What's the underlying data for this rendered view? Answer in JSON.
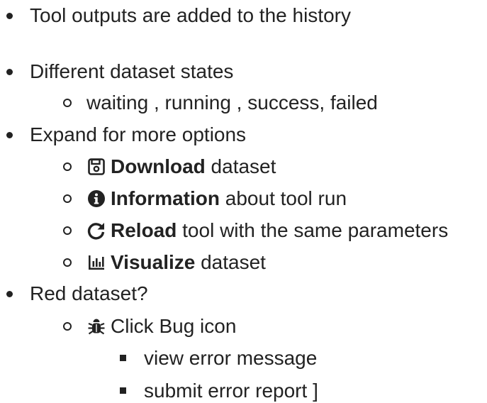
{
  "items": [
    {
      "text": "Tool outputs are added to the history"
    },
    {
      "text": "Different dataset states"
    },
    {
      "text": "waiting , running , success, failed"
    },
    {
      "text": "Expand for more options"
    },
    {
      "bold": "Download",
      "rest": " dataset",
      "icon": "floppy-disk-icon"
    },
    {
      "bold": "Information",
      "rest": " about tool run",
      "icon": "info-circle-icon"
    },
    {
      "bold": "Reload",
      "rest": " tool with the same parameters",
      "icon": "redo-icon"
    },
    {
      "bold": "Visualize",
      "rest": " dataset",
      "icon": "bar-chart-icon"
    },
    {
      "text": "Red dataset?"
    },
    {
      "text": "Click Bug icon",
      "icon": "bug-icon"
    },
    {
      "text": "view error message"
    },
    {
      "text": "submit error report ]"
    }
  ]
}
